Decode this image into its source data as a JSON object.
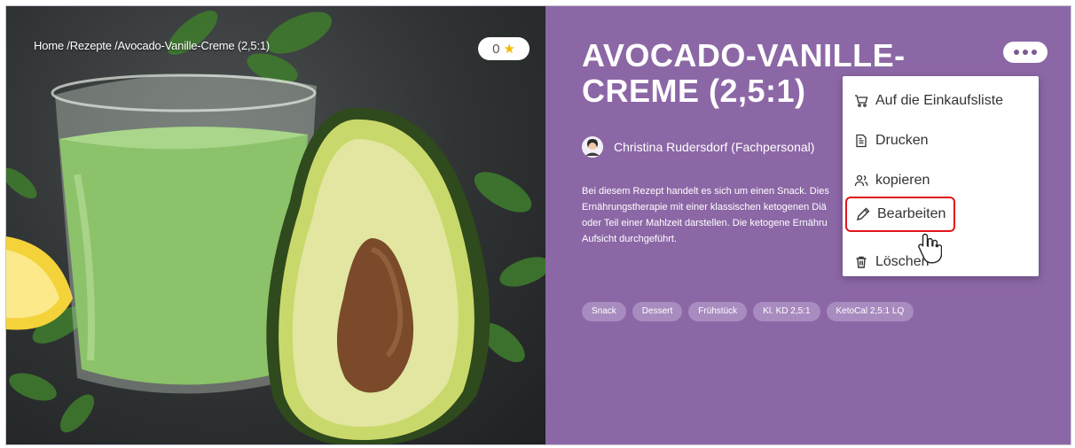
{
  "breadcrumb": {
    "home": "Home /",
    "recipes": "Rezepte /",
    "current": "Avocado-Vanille-Creme (2,5:1)"
  },
  "rating": {
    "count": "0",
    "icon": "star-icon",
    "star_color": "#f5b800"
  },
  "recipe": {
    "title_line1": "AVOCADO-VANILLE-",
    "title_line2": "CREME (2,5:1)",
    "author": "Christina Rudersdorf (Fachpersonal)",
    "description_lines": [
      "Bei diesem Rezept handelt es sich um einen Snack. Dies",
      "Ernährungstherapie mit einer klassischen ketogenen Diä",
      "oder Teil einer Mahlzeit darstellen. Die ketogene Ernähru",
      "Aufsicht durchgeführt."
    ],
    "tags": [
      "Snack",
      "Dessert",
      "Frühstück",
      "Kl. KD 2,5:1",
      "KetoCal 2,5:1 LQ"
    ]
  },
  "menu": {
    "items": [
      {
        "label": "Auf die Einkaufsliste",
        "icon": "cart-icon"
      },
      {
        "label": "Drucken",
        "icon": "document-icon"
      },
      {
        "label": "kopieren",
        "icon": "users-icon"
      },
      {
        "label": "Bearbeiten",
        "icon": "pencil-icon"
      },
      {
        "label": "Löschen",
        "icon": "trash-icon"
      }
    ],
    "highlighted": "Bearbeiten"
  },
  "colors": {
    "panel": "#8c67a6",
    "tag": "#a88bbf",
    "highlight_border": "#e2141b"
  }
}
